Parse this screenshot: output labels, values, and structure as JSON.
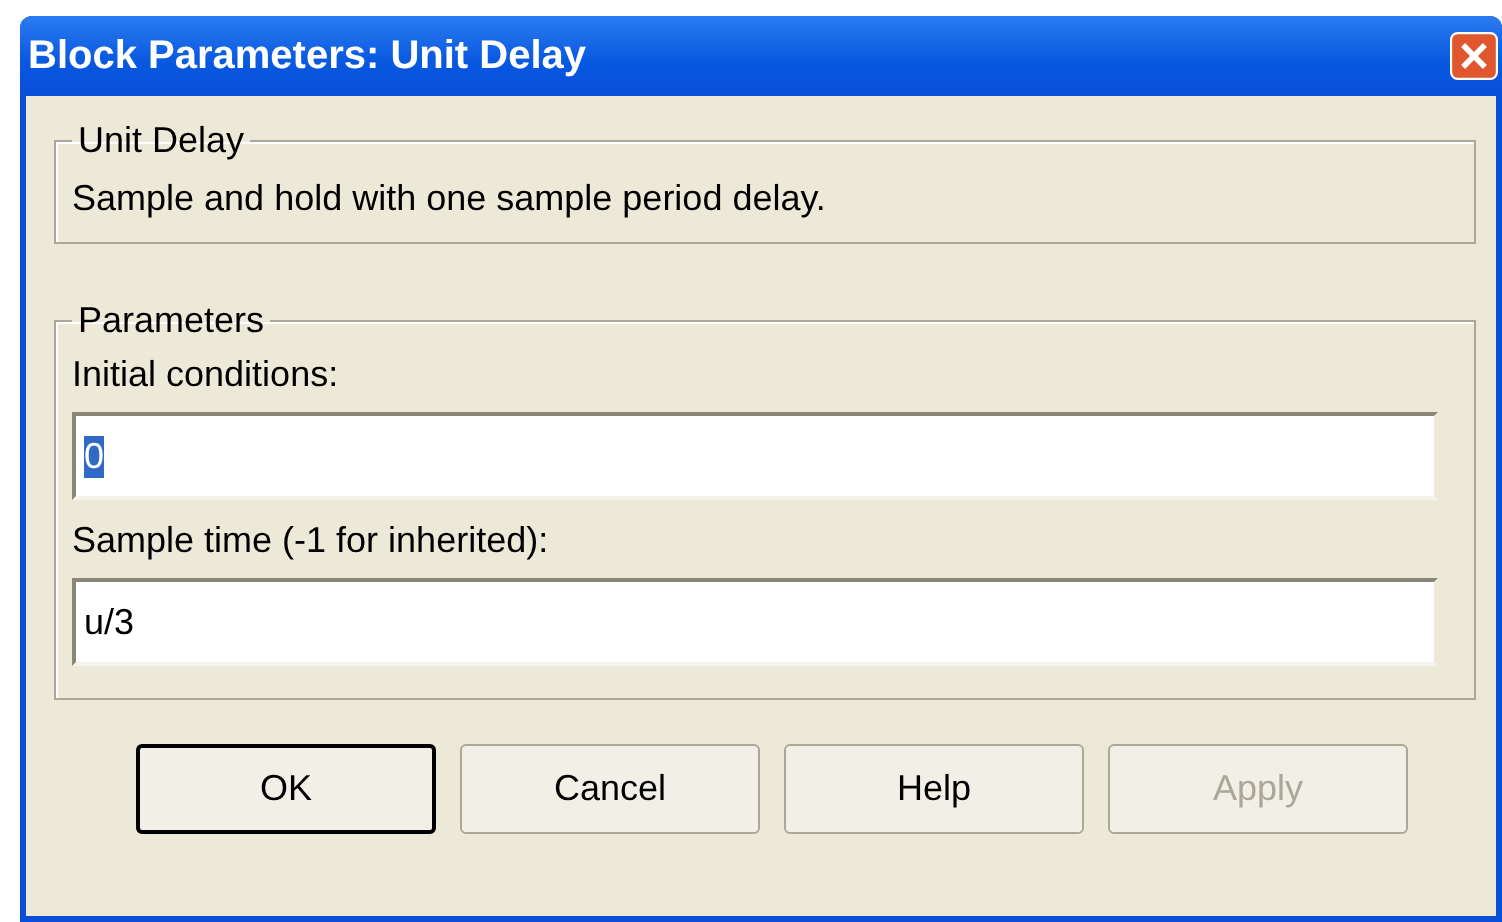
{
  "window": {
    "title": "Block Parameters: Unit Delay"
  },
  "description": {
    "title": "Unit Delay",
    "text": "Sample and hold with one sample period delay."
  },
  "parameters": {
    "title": "Parameters",
    "fields": [
      {
        "label": "Initial conditions:",
        "value": "0",
        "selected": true
      },
      {
        "label": "Sample time (-1 for inherited):",
        "value": "u/3",
        "selected": false
      }
    ]
  },
  "buttons": [
    {
      "label": "OK",
      "default": true,
      "disabled": false
    },
    {
      "label": "Cancel",
      "default": false,
      "disabled": false
    },
    {
      "label": "Help",
      "default": false,
      "disabled": false
    },
    {
      "label": "Apply",
      "default": false,
      "disabled": true
    }
  ]
}
